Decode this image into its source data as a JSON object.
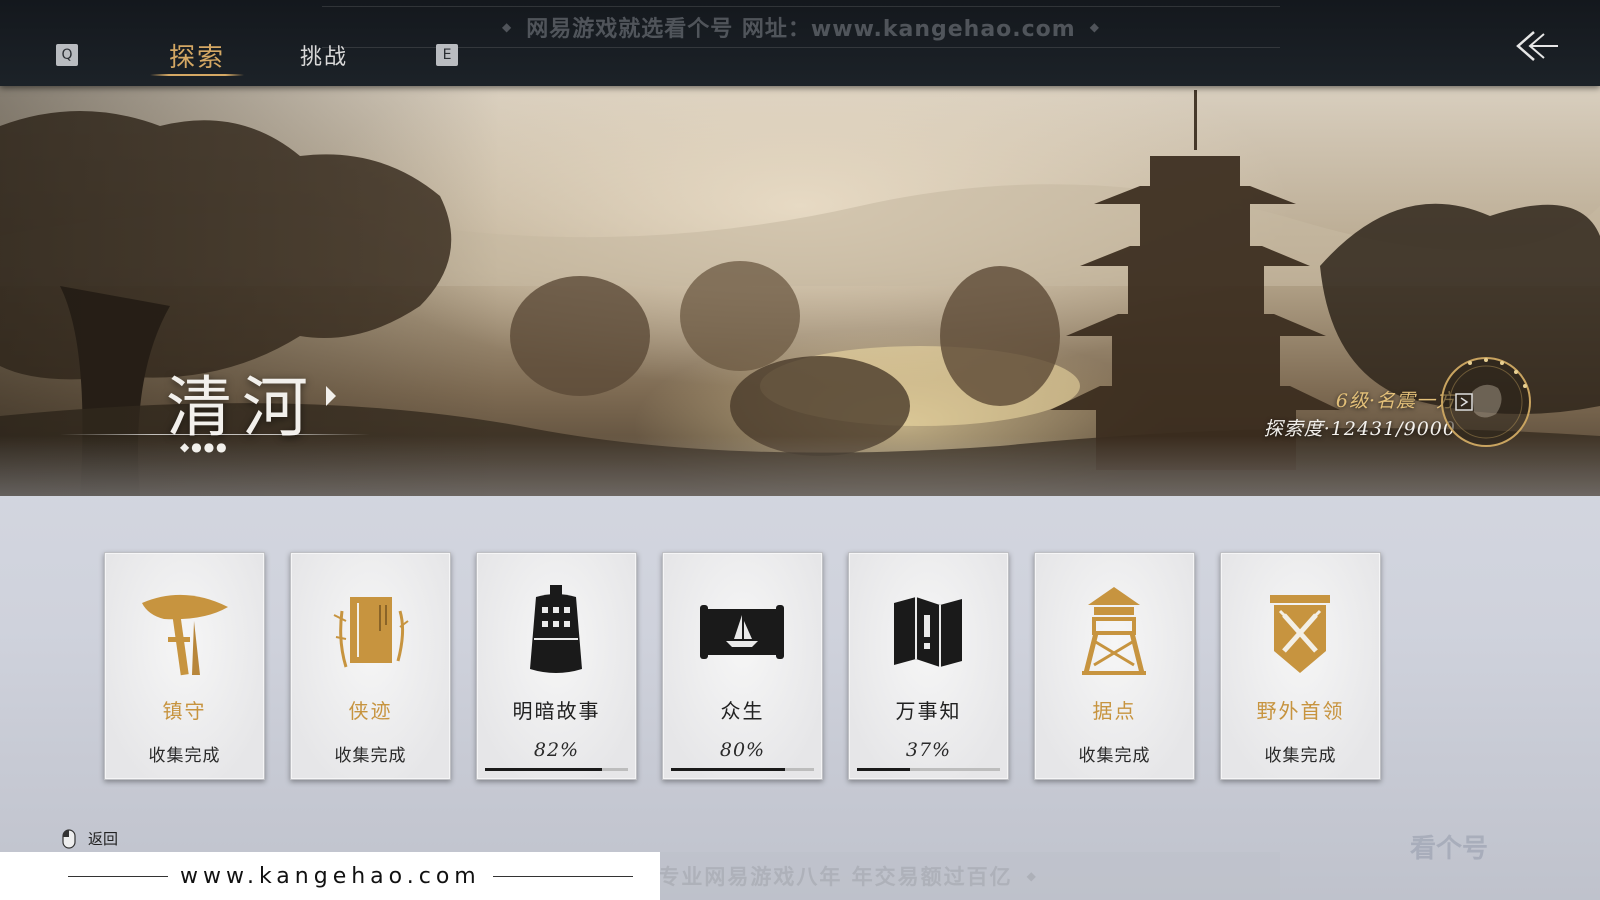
{
  "topbar": {
    "watermark": "网易游戏就选看个号  网址：www.kangehao.com",
    "key_left": "Q",
    "key_right": "E",
    "tabs": [
      {
        "label": "探索",
        "active": true
      },
      {
        "label": "挑战",
        "active": false
      }
    ],
    "back_icon": "back-arrow-icon"
  },
  "banner": {
    "region_name": "清河",
    "page_dots": "◆●●●",
    "rank": "6级·名震一方",
    "exploration": "探索度·12431/9000"
  },
  "cards": [
    {
      "name": "镇守",
      "status": "收集完成",
      "color": "gold",
      "icon": "hat-post-icon"
    },
    {
      "name": "侠迹",
      "status": "收集完成",
      "color": "gold",
      "icon": "book-bamboo-icon"
    },
    {
      "name": "明暗故事",
      "status": "82%",
      "progress": 0.82,
      "color": "dark",
      "icon": "bell-icon"
    },
    {
      "name": "众生",
      "status": "80%",
      "progress": 0.8,
      "color": "dark",
      "icon": "scroll-boat-icon"
    },
    {
      "name": "万事知",
      "status": "37%",
      "progress": 0.37,
      "color": "dark",
      "icon": "folded-map-icon"
    },
    {
      "name": "据点",
      "status": "收集完成",
      "color": "gold",
      "icon": "watchtower-icon"
    },
    {
      "name": "野外首领",
      "status": "收集完成",
      "color": "gold",
      "icon": "crossed-swords-banner-icon"
    }
  ],
  "bottom": {
    "back_hint": "返回",
    "site": "www.kangehao.com",
    "banner": "看个号专业网易游戏八年  年交易额过百亿",
    "corner_logo": "看个号"
  },
  "colors": {
    "gold": "#c7943f",
    "tab_active": "#d5a864",
    "topbar": "#1a1f25"
  }
}
